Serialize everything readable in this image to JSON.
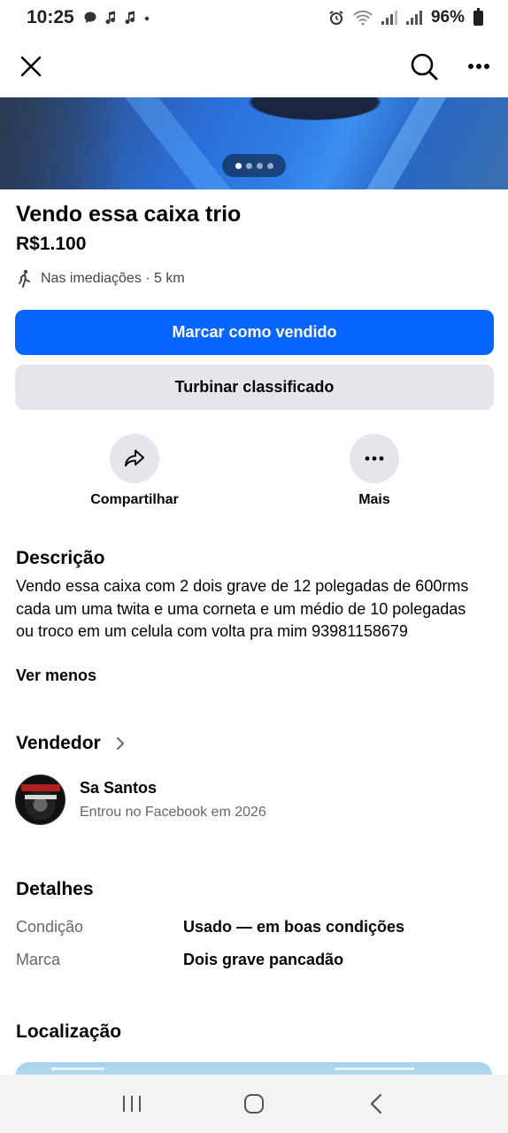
{
  "status_bar": {
    "time": "10:25",
    "notification_icons": [
      "chat-bubble-icon",
      "music-note-icon",
      "music-note-icon",
      "dot-icon"
    ],
    "battery": "96%"
  },
  "nav": {
    "close_icon": "close-icon",
    "search_icon": "search-icon",
    "more_icon": "more-icon"
  },
  "listing": {
    "image_count": 4,
    "image_active_index": 0,
    "title": "Vendo essa caixa trio",
    "price": "R$1.100",
    "location": "Nas imediações · 5 km"
  },
  "buttons": {
    "mark_sold": "Marcar como vendido",
    "boost": "Turbinar classificado"
  },
  "actions": {
    "share": "Compartilhar",
    "more": "Mais"
  },
  "description": {
    "heading": "Descrição",
    "text": "Vendo essa caixa com 2 dois grave de 12 polegadas de 600rms cada um uma twita e uma corneta e um médio de 10 polegadas ou troco em um celula com volta pra mim 93981158679",
    "toggle": "Ver menos"
  },
  "seller": {
    "heading": "Vendedor",
    "name": "Sa Santos",
    "joined": "Entrou no Facebook em 2026"
  },
  "details": {
    "heading": "Detalhes",
    "rows": [
      {
        "label": "Condição",
        "value": "Usado — em boas condições"
      },
      {
        "label": "Marca",
        "value": "Dois grave pancadão"
      }
    ]
  },
  "location_section": {
    "heading": "Localização"
  },
  "colors": {
    "primary": "#0866ff",
    "secondary_bg": "#e4e6eb",
    "text": "#050505",
    "muted": "#65676b"
  }
}
